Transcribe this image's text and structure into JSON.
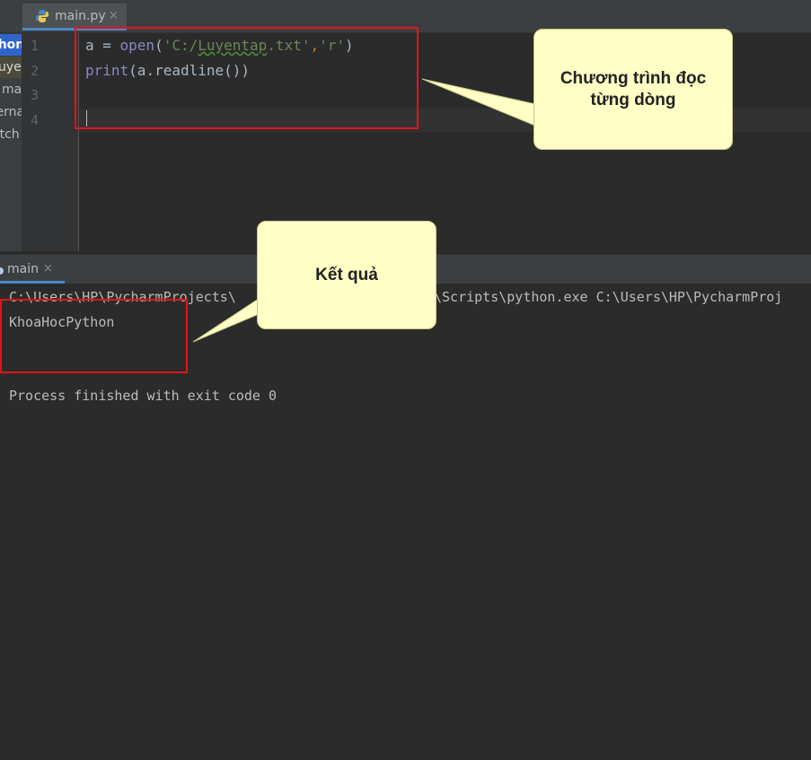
{
  "project_panel": {
    "items": [
      "thon",
      "uyen",
      "main",
      "ternal",
      "atch"
    ]
  },
  "tab": {
    "file_name": "main.py",
    "close_glyph": "×",
    "icon": "python-file-icon"
  },
  "editor": {
    "line_numbers": [
      "1",
      "2",
      "3",
      "4"
    ],
    "lines": {
      "l1": {
        "a": "a = ",
        "fn": "open",
        "p1": "(",
        "s1": "'C:/",
        "s1u": "Luyentap",
        "s1b": ".txt'",
        "comma": ",",
        "s2": "'r'",
        "p2": ")"
      },
      "l2": {
        "fn": "print",
        "rest": "(a.readline())"
      }
    }
  },
  "run_panel": {
    "tab_label": "main",
    "close_glyph": "×",
    "console": {
      "cmd_left": "C:\\Users\\HP\\PycharmProjects\\",
      "cmd_right": "\\Scripts\\python.exe C:\\Users\\HP\\PycharmProj",
      "output": "KhoaHocPython",
      "exit": "Process finished with exit code 0"
    }
  },
  "annotations": {
    "callout_code": "Chương trình đọc từng dòng",
    "callout_result": "Kết quả"
  },
  "colors": {
    "highlight_box": "#e2141c",
    "callout_bg": "#ffffc6",
    "editor_bg": "#2b2b2b"
  }
}
